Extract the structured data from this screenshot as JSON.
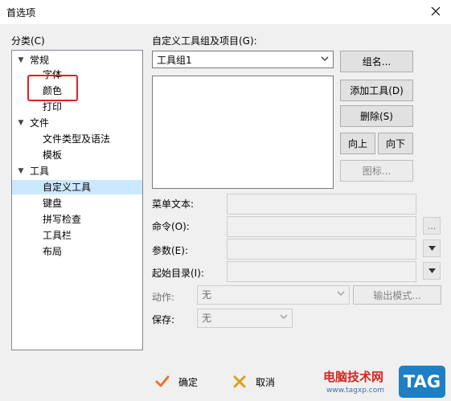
{
  "window": {
    "title": "首选项"
  },
  "tree": {
    "label": "分类(C)",
    "items": [
      {
        "text": "常规",
        "level": 0,
        "expanded": true
      },
      {
        "text": "字体",
        "level": 1
      },
      {
        "text": "颜色",
        "level": 1
      },
      {
        "text": "打印",
        "level": 1
      },
      {
        "text": "文件",
        "level": 0,
        "expanded": true
      },
      {
        "text": "文件类型及语法",
        "level": 1
      },
      {
        "text": "模板",
        "level": 1
      },
      {
        "text": "工具",
        "level": 0,
        "expanded": true
      },
      {
        "text": "自定义工具",
        "level": 1,
        "selected": true
      },
      {
        "text": "键盘",
        "level": 1
      },
      {
        "text": "拼写检查",
        "level": 1
      },
      {
        "text": "工具栏",
        "level": 1
      },
      {
        "text": "布局",
        "level": 1
      }
    ]
  },
  "tools": {
    "group_label": "自定义工具组及项目(G):",
    "group_value": "工具组1",
    "group_name_btn": "组名...",
    "add_tool_btn": "添加工具(D)",
    "delete_btn": "删除(S)",
    "up_btn": "向上",
    "down_btn": "向下",
    "icon_btn": "图标..."
  },
  "form": {
    "menu_text_label": "菜单文本:",
    "command_label": "命令(O):",
    "command_browse": "...",
    "args_label": "参数(E):",
    "start_dir_label": "起始目录(I):",
    "action_label": "动作:",
    "action_value": "无",
    "output_mode_btn": "输出模式...",
    "save_label": "保存:",
    "save_value": "无"
  },
  "footer": {
    "ok_label": "确定",
    "cancel_label": "取消"
  },
  "watermark": {
    "main": "电脑技术网",
    "sub": "www.tagxp.com",
    "tag": "TAG"
  },
  "colors": {
    "selection": "#cce8ff",
    "highlight_box": "#e02020",
    "ok_check": "#e8772e",
    "cancel_x": "#d9a11c"
  }
}
